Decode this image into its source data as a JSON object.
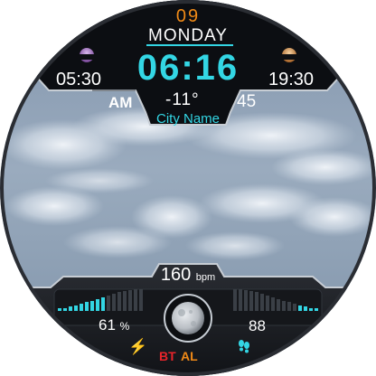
{
  "watch": {
    "date": "09",
    "day": "MONDAY",
    "time": "06:16",
    "sunrise": "05:30",
    "sunset": "19:30",
    "ampm": "AM",
    "temperature": "-11°",
    "seconds": "45",
    "city": "City Name",
    "heart_rate": "160",
    "heart_rate_unit": "bpm",
    "battery": "61",
    "battery_unit": "%",
    "steps": "88",
    "bt_label": "BT",
    "alarm_label": "AL"
  },
  "icons": {
    "sunrise": "sunrise-planet-icon",
    "sunset": "sunset-planet-icon",
    "moon": "moon-phase-icon",
    "charging": "lightning-bolt-icon",
    "steps": "footsteps-icon"
  },
  "colors": {
    "accent_cyan": "#33d6e4",
    "accent_orange": "#f08a17",
    "alert_red": "#e8242a",
    "sunrise_planet": "#a77cc4",
    "sunset_planet": "#d79a57"
  },
  "levels": {
    "left_bar_fill": 0.45,
    "right_bar_fill": 0.28
  }
}
